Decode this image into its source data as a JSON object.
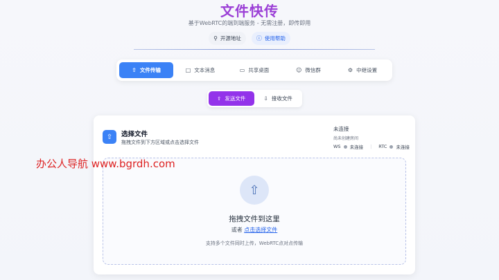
{
  "header": {
    "title": "文件快传",
    "subtitle": "基于WebRTC的端到端服务 - 无需注册，即传即用",
    "links": [
      {
        "label": "开源地址",
        "icon": "github-icon"
      },
      {
        "label": "使用帮助",
        "icon": "help-circle-icon"
      }
    ]
  },
  "tabs": [
    {
      "label": "文件传输",
      "icon": "upload-icon",
      "active": true
    },
    {
      "label": "文本消息",
      "icon": "message-icon",
      "active": false
    },
    {
      "label": "共享桌面",
      "icon": "monitor-icon",
      "active": false
    },
    {
      "label": "微信群",
      "icon": "users-icon",
      "active": false
    },
    {
      "label": "中继设置",
      "icon": "gear-icon",
      "active": false
    }
  ],
  "mode": {
    "send_label": "发送文件",
    "receive_label": "接收文件"
  },
  "card": {
    "title": "选择文件",
    "description": "拖拽文件到下方区域或点击选择文件",
    "status": {
      "main": "未连接",
      "sub": "尚未创建房间",
      "ws_label": "WS",
      "ws_status": "未连接",
      "rtc_label": "RTC",
      "rtc_status": "未连接"
    },
    "dropzone": {
      "title": "拖拽文件到这里",
      "or_text": "或者",
      "link_text": "点击选择文件",
      "hint": "支持多个文件同时上传，WebRTC点对点传输"
    }
  },
  "watermark": "办公人导航 www.bgrdh.com",
  "colors": {
    "title": "#9b3fd6",
    "active_tab": "#3b82f6",
    "active_mode": "#9333ea",
    "link": "#2563eb"
  }
}
